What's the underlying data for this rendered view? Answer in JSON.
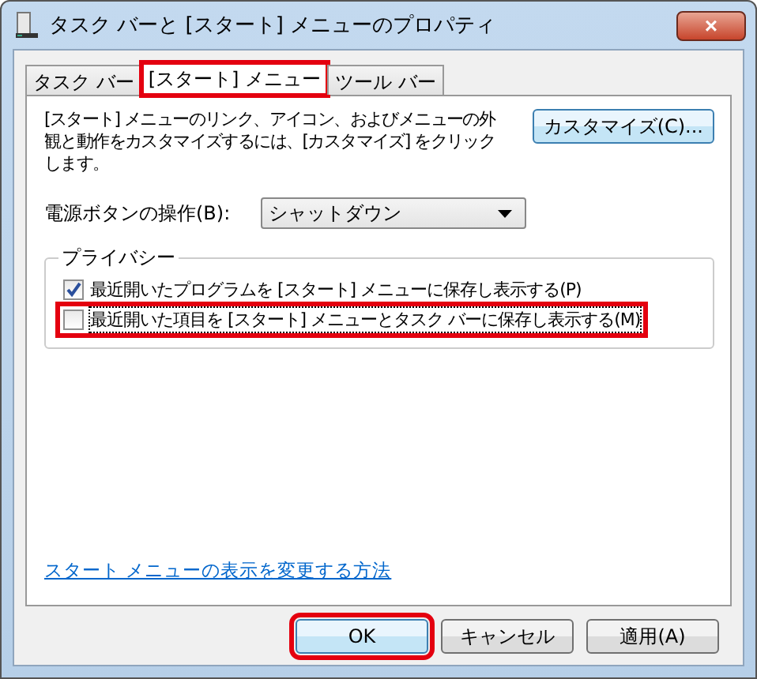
{
  "window": {
    "title": "タスク バーと [スタート] メニューのプロパティ",
    "close": "×"
  },
  "tabs": [
    {
      "label": "タスク バー",
      "selected": false,
      "highlighted": false
    },
    {
      "label": "[スタート] メニュー",
      "selected": true,
      "highlighted": true
    },
    {
      "label": "ツール バー",
      "selected": false,
      "highlighted": false
    }
  ],
  "description": "[スタート] メニューのリンク、アイコン、およびメニューの外観と動作をカスタマイズするには、[カスタマイズ] をクリックします。",
  "customize_button": "カスタマイズ(C)...",
  "power_button": {
    "label": "電源ボタンの操作(B):",
    "value": "シャットダウン"
  },
  "privacy": {
    "title": "プライバシー",
    "options": [
      {
        "label": "最近開いたプログラムを [スタート] メニューに保存し表示する(P)",
        "checked": true,
        "highlighted": false
      },
      {
        "label": "最近開いた項目を [スタート] メニューとタスク バーに保存し表示する(M)",
        "checked": false,
        "highlighted": true
      }
    ]
  },
  "help_link": "スタート メニューの表示を変更する方法",
  "buttons": [
    {
      "label": "OK",
      "highlighted": true
    },
    {
      "label": "キャンセル",
      "highlighted": false
    },
    {
      "label": "適用(A)",
      "highlighted": false
    }
  ]
}
